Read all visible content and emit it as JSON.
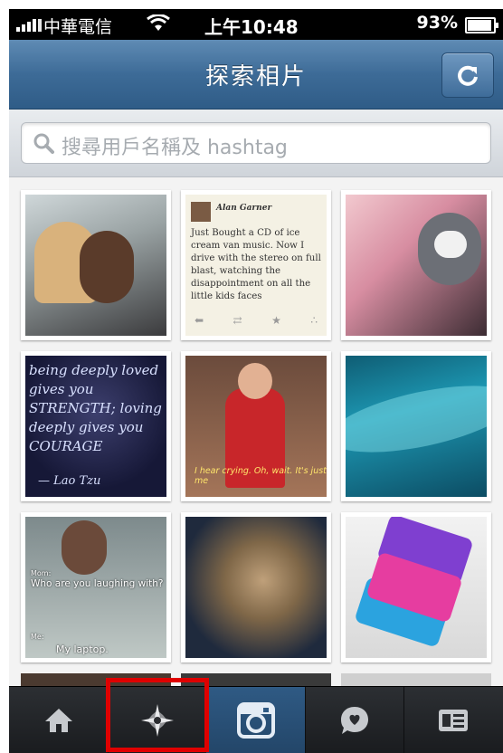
{
  "status_bar": {
    "carrier": "中華電信",
    "time": "上午10:48",
    "battery": "93%"
  },
  "nav": {
    "title": "探索相片",
    "refresh_icon": "refresh-icon"
  },
  "search": {
    "placeholder": "搜尋用戶名稱及 hashtag"
  },
  "grid": {
    "tweet": {
      "author": "Alan Garner",
      "text": "Just Bought a CD of ice cream van music. Now I drive with the stereo on full blast, watching the disappointment on all the little kids faces"
    },
    "quote": {
      "text": "being deeply loved gives you STRENGTH; loving deeply gives you COURAGE",
      "attribution": "— Lao Tzu"
    },
    "caption_tv": "I hear crying. Oh, wait. It's just me",
    "meme": {
      "label_top": "Mom:",
      "question": "Who are you laughing with?",
      "label_bottom": "Me:",
      "answer": "My laptop."
    }
  },
  "tabbar": {
    "items": [
      {
        "icon": "home-icon"
      },
      {
        "icon": "explore-icon"
      },
      {
        "icon": "camera-icon"
      },
      {
        "icon": "news-icon"
      },
      {
        "icon": "profile-icon"
      }
    ],
    "active_index": 2,
    "highlight_color": "#e00000"
  },
  "colors": {
    "nav_blue": "#3d6b97",
    "tab_active": "#2f5a84"
  }
}
